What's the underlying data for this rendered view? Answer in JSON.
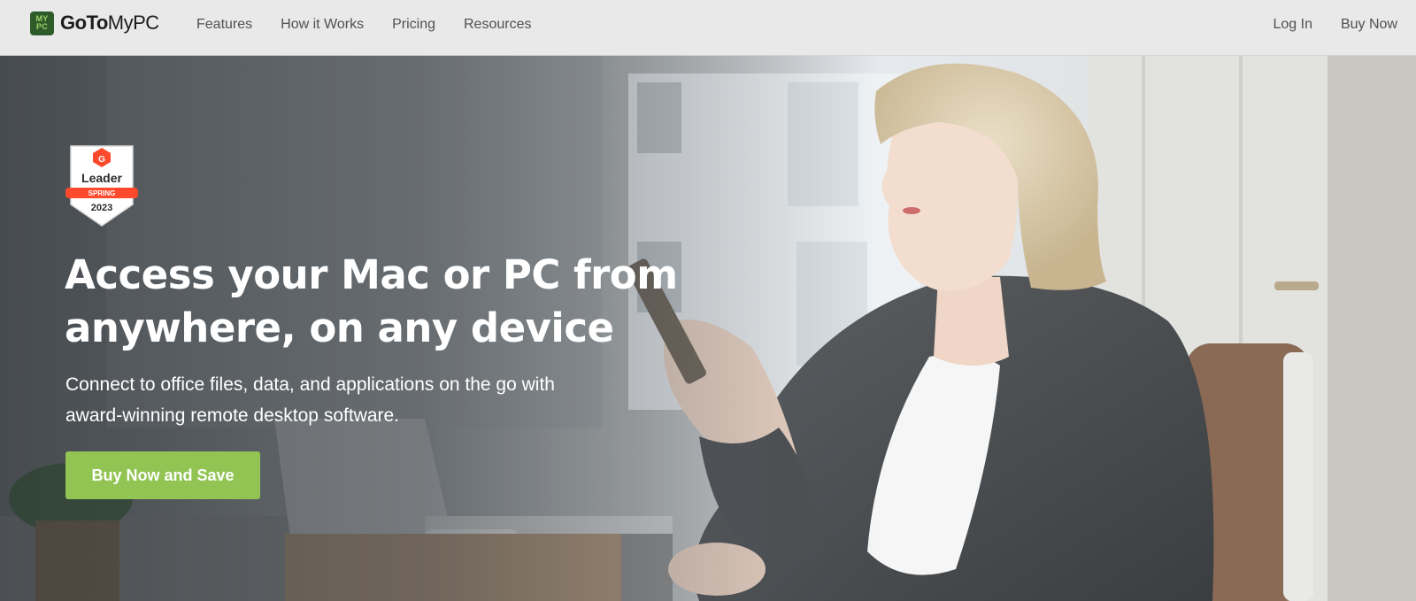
{
  "brand": {
    "logo_mark_top": "MY",
    "logo_mark_bottom": "PC",
    "name_bold": "GoTo",
    "name_light": "MyPC"
  },
  "nav": {
    "links": [
      "Features",
      "How it Works",
      "Pricing",
      "Resources"
    ],
    "right": [
      "Log In",
      "Buy Now"
    ]
  },
  "hero": {
    "badge": {
      "brand_letter": "G",
      "title": "Leader",
      "season": "SPRING",
      "year": "2023",
      "ribbon_color": "#ff492c"
    },
    "title_line1": "Access your Mac or PC from",
    "title_line2": "anywhere, on any device",
    "subtitle_line1": "Connect to office files, data, and applications on the go with",
    "subtitle_line2": "award-winning remote desktop software.",
    "cta_label": "Buy Now and Save",
    "cta_color": "#92c454"
  },
  "colors": {
    "nav_background": "#e9e9e9",
    "logo_green": "#2d5b2a",
    "logo_accent": "#9fd06a"
  }
}
